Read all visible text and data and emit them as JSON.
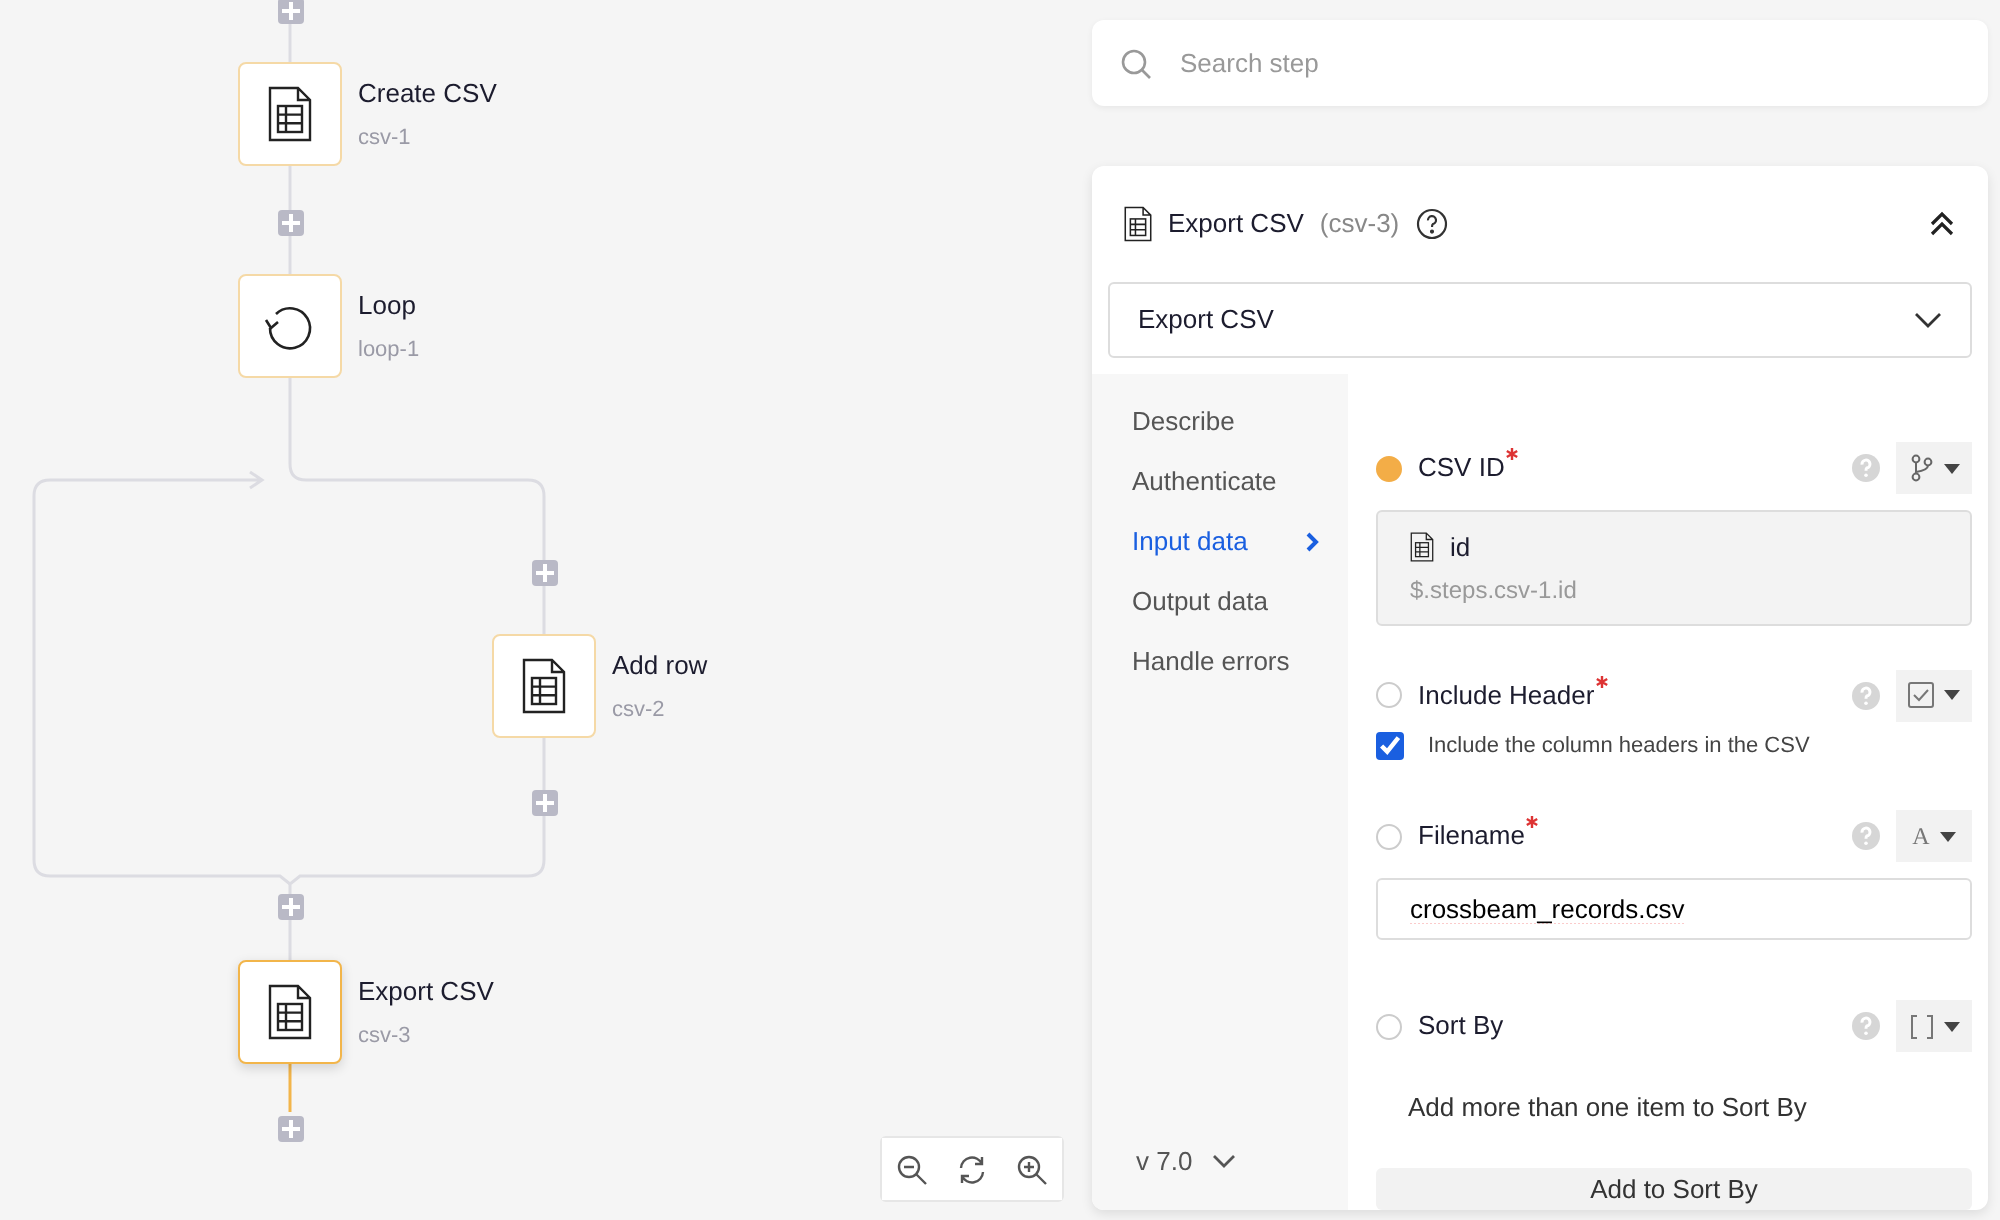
{
  "canvas": {
    "nodes": [
      {
        "title": "Create CSV",
        "step_id": "csv-1",
        "kind": "csv",
        "selected": false
      },
      {
        "title": "Loop",
        "step_id": "loop-1",
        "kind": "loop",
        "selected": false
      },
      {
        "title": "Add row",
        "step_id": "csv-2",
        "kind": "csv",
        "selected": false
      },
      {
        "title": "Export CSV",
        "step_id": "csv-3",
        "kind": "csv",
        "selected": true
      }
    ]
  },
  "search": {
    "placeholder": "Search step"
  },
  "step_panel": {
    "title": "Export CSV",
    "step_id": "(csv-3)",
    "expanded": true,
    "action_select": {
      "value": "Export CSV"
    },
    "nav": [
      {
        "label": "Describe",
        "selected": false
      },
      {
        "label": "Authenticate",
        "selected": false
      },
      {
        "label": "Input data",
        "selected": true
      },
      {
        "label": "Output data",
        "selected": false
      },
      {
        "label": "Handle errors",
        "selected": false
      }
    ],
    "version": "v 7.0",
    "fields": [
      {
        "kind": "reference",
        "label": "CSV ID",
        "required": true,
        "set": true,
        "ref_name": "id",
        "ref_path": "$.steps.csv-1.id"
      },
      {
        "kind": "checkbox",
        "label": "Include Header",
        "required": true,
        "set": false,
        "checked": true,
        "checkbox_label": "Include the column headers in the CSV"
      },
      {
        "kind": "text",
        "label": "Filename",
        "required": true,
        "set": false,
        "type_glyph": "A",
        "value": "crossbeam_records.csv"
      },
      {
        "kind": "list",
        "label": "Sort By",
        "required": false,
        "set": false,
        "hint": "Add more than one item to Sort By",
        "add_button": "Add to Sort By"
      }
    ]
  }
}
